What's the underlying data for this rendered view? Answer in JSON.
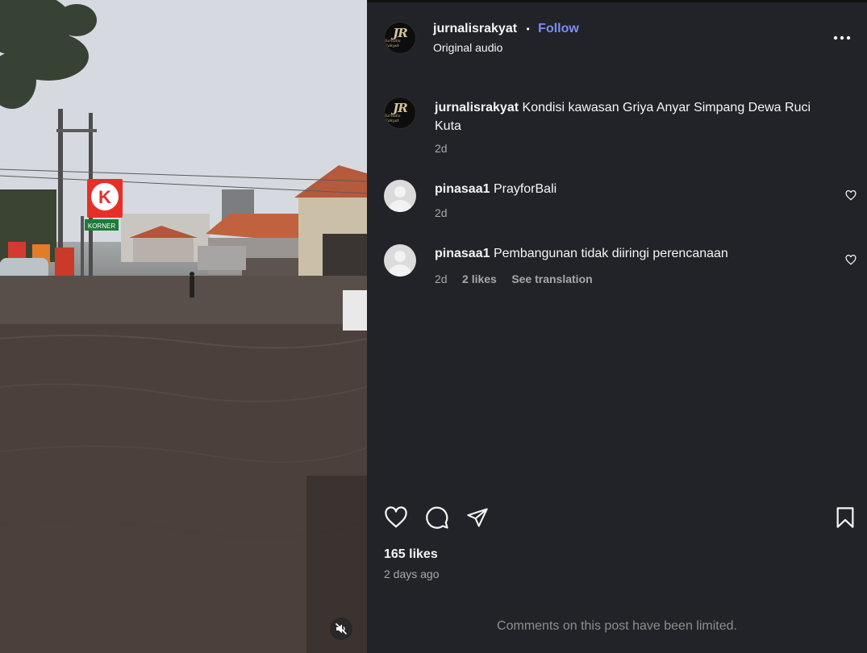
{
  "header": {
    "username": "jurnalisrakyat",
    "separator": "•",
    "follow_label": "Follow",
    "audio_label": "Original audio",
    "avatar_monogram": "JR",
    "avatar_subtext": "Jurnalis Rakyat",
    "more_icon": "more-horizontal-icon"
  },
  "caption": {
    "username": "jurnalisrakyat",
    "text": "Kondisi kawasan Griya Anyar Simpang Dewa Ruci",
    "text_line2": "Kuta",
    "time": "2d"
  },
  "comments": [
    {
      "username": "pinasaa1",
      "text": "PrayforBali",
      "time": "2d",
      "likes": "",
      "translate": ""
    },
    {
      "username": "pinasaa1",
      "text": "Pembangunan tidak diiringi perencanaan",
      "time": "2d",
      "likes": "2 likes",
      "translate": "See translation"
    }
  ],
  "actions": {
    "like_icon": "heart-icon",
    "comment_icon": "comment-icon",
    "share_icon": "send-icon",
    "save_icon": "bookmark-icon"
  },
  "stats": {
    "likes": "165 likes",
    "posted": "2 days ago"
  },
  "footer": {
    "limited_notice": "Comments on this post have been limited."
  },
  "media": {
    "store_sign": "K",
    "store_subsign": "KORNER",
    "mute_icon": "speaker-muted-icon"
  },
  "colors": {
    "panel_bg": "#212328",
    "follow_blue": "#7f8cf6",
    "muted_text": "#a8a8a8",
    "store_red": "#e63027"
  }
}
